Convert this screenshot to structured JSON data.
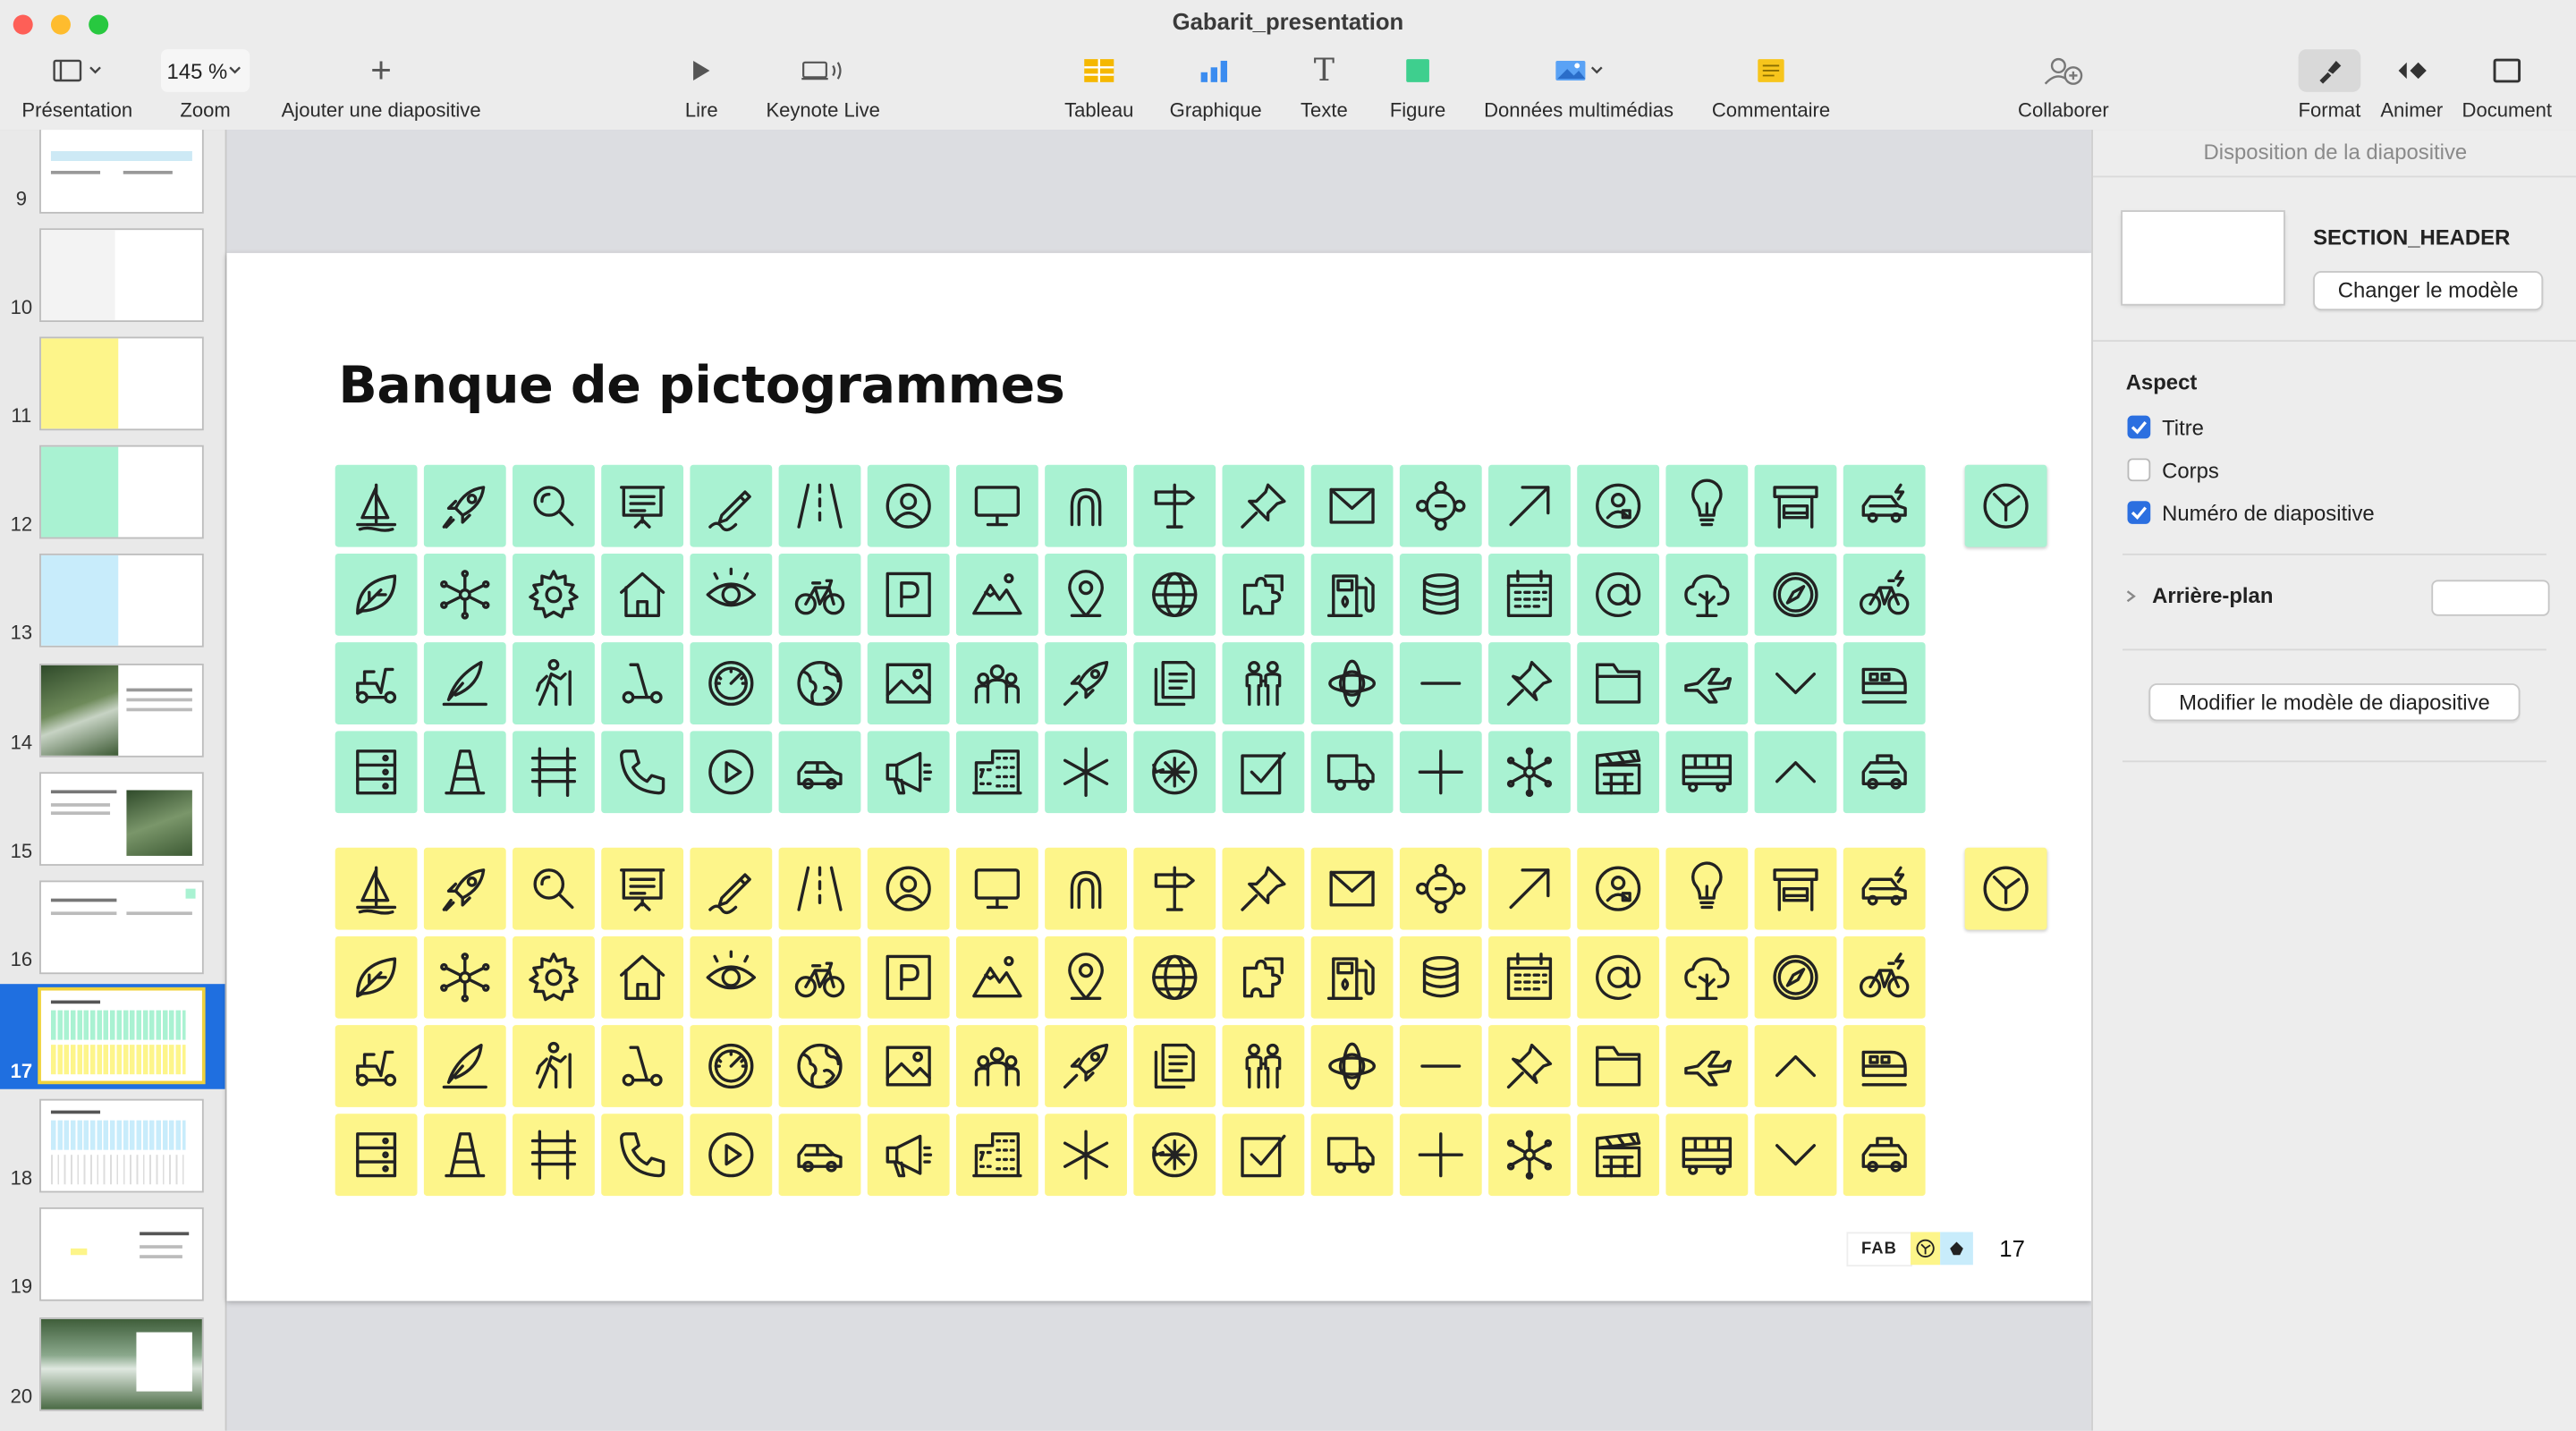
{
  "window": {
    "title": "Gabarit_presentation"
  },
  "toolbar": {
    "presentation": "Présentation",
    "zoom_value": "145 %",
    "zoom": "Zoom",
    "add_slide": "Ajouter une diapositive",
    "play": "Lire",
    "keynote_live": "Keynote Live",
    "table": "Tableau",
    "chart": "Graphique",
    "text": "Texte",
    "shape": "Figure",
    "media": "Données multimédias",
    "comment": "Commentaire",
    "collaborate": "Collaborer",
    "format": "Format",
    "animate": "Animer",
    "document": "Document",
    "text_icon_glyph": "T",
    "add_icon_glyph": "+"
  },
  "sidebar": {
    "slides": [
      {
        "num": "9"
      },
      {
        "num": "10"
      },
      {
        "num": "11"
      },
      {
        "num": "12"
      },
      {
        "num": "13"
      },
      {
        "num": "14"
      },
      {
        "num": "15"
      },
      {
        "num": "16"
      },
      {
        "num": "17",
        "selected": true
      },
      {
        "num": "18"
      },
      {
        "num": "19"
      },
      {
        "num": "20"
      }
    ]
  },
  "slide": {
    "title": "Banque de pictogrammes",
    "footer_logo": "FAB",
    "number": "17",
    "green_color": "#a9f2d2",
    "yellow_color": "#fdf58a",
    "green_icons": [
      "sailboat-icon",
      "rocket-icon",
      "magnifier-icon",
      "presentation-board-icon",
      "pen-sign-icon",
      "road-icon",
      "user-circle-icon",
      "monitor-icon",
      "horseshoe-icon",
      "signpost-icon",
      "pin-icon",
      "envelope-icon",
      "network-cycle-icon",
      "arrow-up-right-icon",
      "user-badge-icon",
      "lightbulb-icon",
      "bus-stop-icon",
      "electric-car-icon",
      "leaf-icon",
      "molecule-icon",
      "gear-icon",
      "house-icon",
      "eye-icon",
      "bicycle-icon",
      "parking-icon",
      "mountain-icon",
      "location-pin-icon",
      "globe-icon",
      "puzzle-icon",
      "fuel-pump-icon",
      "coins-icon",
      "calendar-icon",
      "at-sign-icon",
      "tree-icon",
      "compass-icon",
      "e-bike-icon",
      "scooter-icon",
      "feather-pen-icon",
      "hiker-icon",
      "kick-scooter-icon",
      "speedometer-icon",
      "earth-icon",
      "image-icon",
      "group-icon",
      "rocket-launch-icon",
      "documents-icon",
      "people-pair-icon",
      "atom-icon",
      "minus-icon",
      "thumbtack-icon",
      "folder-icon",
      "airplane-icon",
      "chevron-down-icon",
      "train-icon",
      "server-icon",
      "traffic-cone-icon",
      "railway-icon",
      "phone-icon",
      "play-circle-icon",
      "car-icon",
      "megaphone-icon",
      "building-icon",
      "asterisk-icon",
      "sync-icon",
      "checkbox-icon",
      "truck-icon",
      "plus-icon",
      "snowflake-icon",
      "clapperboard-icon",
      "coach-icon",
      "chevron-up-icon",
      "taxi-icon"
    ],
    "yellow_icons": [
      "sailboat-icon",
      "rocket-icon",
      "magnifier-icon",
      "presentation-board-icon",
      "pen-sign-icon",
      "road-icon",
      "user-circle-icon",
      "monitor-icon",
      "horseshoe-icon",
      "signpost-icon",
      "pin-icon",
      "envelope-icon",
      "network-cycle-icon",
      "arrow-up-right-icon",
      "user-badge-icon",
      "lightbulb-icon",
      "bus-stop-icon",
      "electric-car-icon",
      "leaf-icon",
      "molecule-icon",
      "gear-icon",
      "house-icon",
      "eye-icon",
      "bicycle-icon",
      "parking-icon",
      "mountain-icon",
      "location-pin-icon",
      "globe-icon",
      "puzzle-icon",
      "fuel-pump-icon",
      "coins-icon",
      "calendar-icon",
      "at-sign-icon",
      "tree-icon",
      "compass-icon",
      "e-bike-icon",
      "scooter-icon",
      "feather-pen-icon",
      "hiker-icon",
      "kick-scooter-icon",
      "speedometer-icon",
      "earth-icon",
      "image-icon",
      "group-icon",
      "rocket-launch-icon",
      "documents-icon",
      "people-pair-icon",
      "atom-icon",
      "minus-icon",
      "thumbtack-icon",
      "folder-icon",
      "airplane-icon",
      "chevron-up-icon",
      "train-icon",
      "server-icon",
      "traffic-cone-icon",
      "railway-icon",
      "phone-icon",
      "play-circle-icon",
      "car-icon",
      "megaphone-icon",
      "building-icon",
      "asterisk-icon",
      "sync-icon",
      "checkbox-icon",
      "truck-icon",
      "plus-icon",
      "snowflake-icon",
      "clapperboard-icon",
      "coach-icon",
      "chevron-down-icon",
      "taxi-icon"
    ],
    "extra_icon": "clock-y-icon"
  },
  "inspector": {
    "header": "Disposition de la diapositive",
    "layout_name": "SECTION_HEADER",
    "change_template": "Changer le modèle",
    "appearance": "Aspect",
    "title_label": "Titre",
    "body_label": "Corps",
    "slide_number_label": "Numéro de diapositive",
    "background_label": "Arrière-plan",
    "edit_master": "Modifier le modèle de diapositive"
  }
}
